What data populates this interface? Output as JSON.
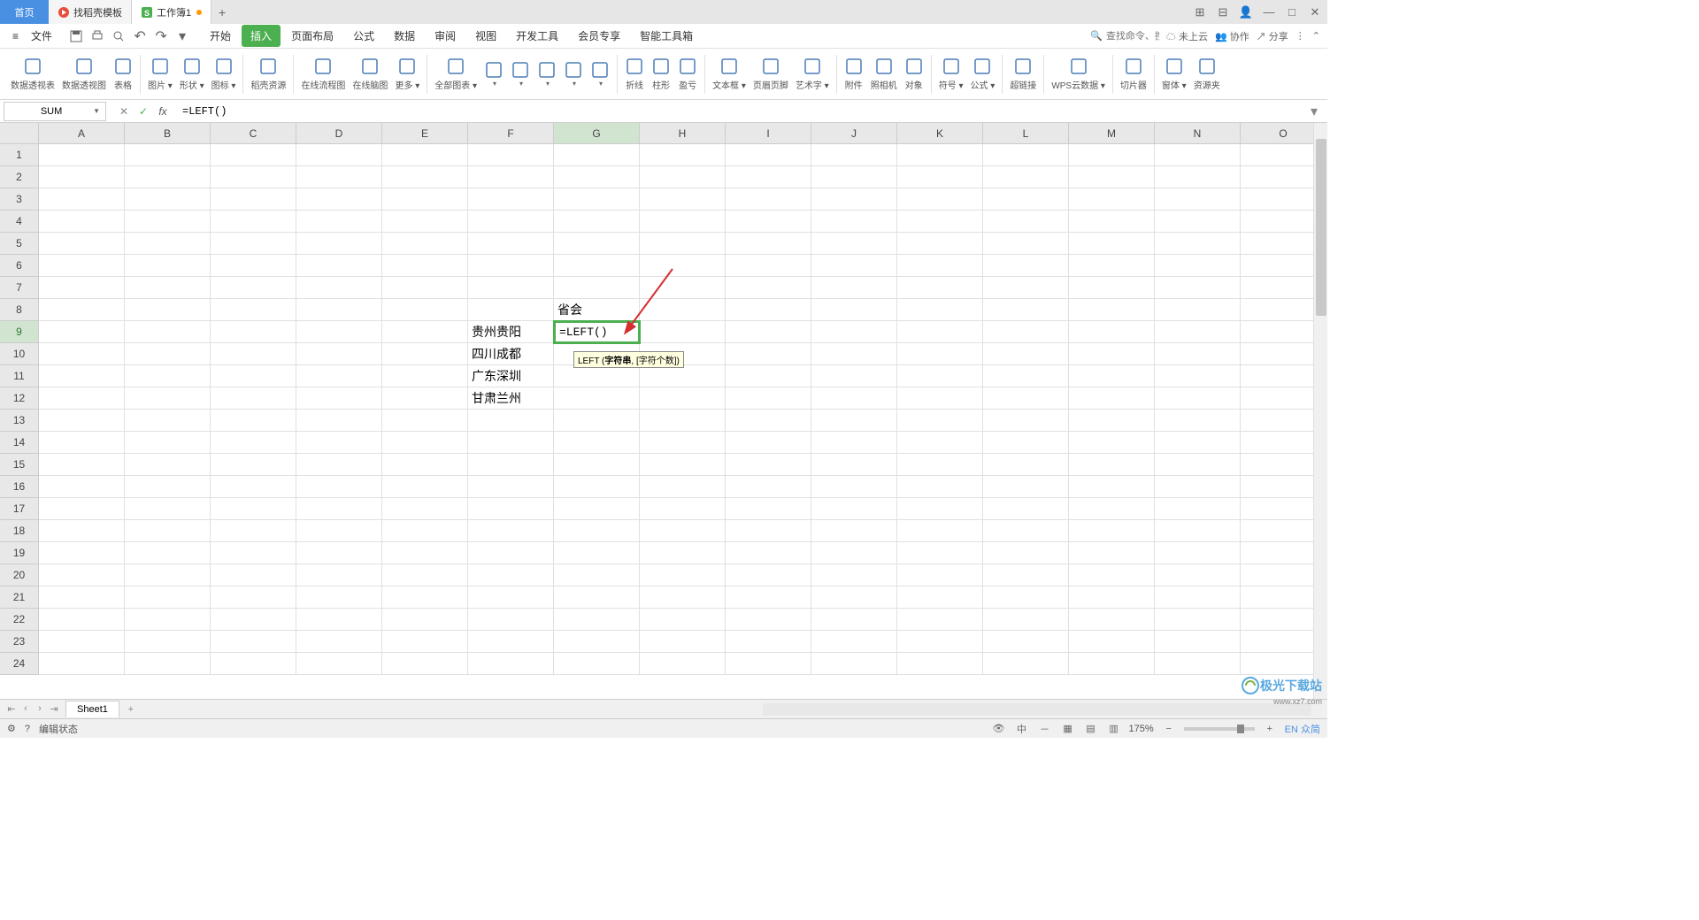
{
  "titlebar": {
    "home_tab": "首页",
    "template_tab": "找稻壳模板",
    "doc_tab": "工作簿1",
    "add": "+"
  },
  "window_controls": {
    "layout1": "⊞",
    "layout2": "⊟",
    "user": "👤",
    "min": "—",
    "max": "□",
    "close": "✕"
  },
  "menubar": {
    "file": "文件",
    "tabs": [
      "开始",
      "插入",
      "页面布局",
      "公式",
      "数据",
      "审阅",
      "视图",
      "开发工具",
      "会员专享",
      "智能工具箱"
    ],
    "active_tab": 1,
    "search_placeholder": "查找命令、搜索模板",
    "cloud": "未上云",
    "coop": "协作",
    "share": "分享"
  },
  "ribbon": {
    "items": [
      {
        "label": "数据透视表",
        "icon": "pivot"
      },
      {
        "label": "数据透视图",
        "icon": "pivotchart"
      },
      {
        "label": "表格",
        "icon": "table"
      },
      {
        "label": "图片",
        "icon": "picture",
        "drop": true
      },
      {
        "label": "形状",
        "icon": "shapes",
        "drop": true
      },
      {
        "label": "图标",
        "icon": "icons",
        "drop": true
      },
      {
        "label": "稻壳资源",
        "icon": "resource"
      },
      {
        "label": "在线流程图",
        "icon": "flowchart"
      },
      {
        "label": "在线脑图",
        "icon": "mindmap"
      },
      {
        "label": "更多",
        "icon": "more",
        "drop": true
      },
      {
        "label": "全部图表",
        "icon": "allcharts",
        "drop": true
      },
      {
        "label": "",
        "icon": "chart1",
        "drop": true
      },
      {
        "label": "",
        "icon": "chart2",
        "drop": true
      },
      {
        "label": "",
        "icon": "chart3",
        "drop": true
      },
      {
        "label": "",
        "icon": "chart4",
        "drop": true
      },
      {
        "label": "",
        "icon": "chart5",
        "drop": true
      },
      {
        "label": "折线",
        "icon": "sparkline"
      },
      {
        "label": "柱形",
        "icon": "sparkcol"
      },
      {
        "label": "盈亏",
        "icon": "sparkwin"
      },
      {
        "label": "文本框",
        "icon": "textbox",
        "drop": true
      },
      {
        "label": "页眉页脚",
        "icon": "headerfooter"
      },
      {
        "label": "艺术字",
        "icon": "wordart",
        "drop": true
      },
      {
        "label": "附件",
        "icon": "attach"
      },
      {
        "label": "照相机",
        "icon": "camera"
      },
      {
        "label": "对象",
        "icon": "object"
      },
      {
        "label": "符号",
        "icon": "symbol",
        "drop": true
      },
      {
        "label": "公式",
        "icon": "equation",
        "drop": true
      },
      {
        "label": "超链接",
        "icon": "hyperlink"
      },
      {
        "label": "WPS云数据",
        "icon": "clouddata",
        "drop": true
      },
      {
        "label": "切片器",
        "icon": "slicer"
      },
      {
        "label": "窗体",
        "icon": "form",
        "drop": true
      },
      {
        "label": "资源夹",
        "icon": "folder"
      }
    ]
  },
  "formula_bar": {
    "name_box": "SUM",
    "formula": "=LEFT()"
  },
  "grid": {
    "columns": [
      "A",
      "B",
      "C",
      "D",
      "E",
      "F",
      "G",
      "H",
      "I",
      "J",
      "K",
      "L",
      "M",
      "N",
      "O"
    ],
    "active_col": "G",
    "rows": [
      1,
      2,
      3,
      4,
      5,
      6,
      7,
      8,
      9,
      10,
      11,
      12,
      13,
      14,
      15,
      16,
      17,
      18,
      19,
      20,
      21,
      22,
      23,
      24
    ],
    "active_row": 9,
    "cells": {
      "G8": "省会",
      "F9": "贵州贵阳",
      "F10": "四川成都",
      "F11": "广东深圳",
      "F12": "甘肃兰州",
      "G9": "=LEFT()"
    },
    "tooltip_prefix": "LEFT (",
    "tooltip_bold": "字符串",
    "tooltip_suffix": ", [字符个数])"
  },
  "sheet_bar": {
    "sheet": "Sheet1",
    "add": "+"
  },
  "statusbar": {
    "mode": "编辑状态",
    "zoom": "175%",
    "ime": "EN 众简"
  },
  "watermark": {
    "main": "极光下载站",
    "sub": "www.xz7.com"
  }
}
